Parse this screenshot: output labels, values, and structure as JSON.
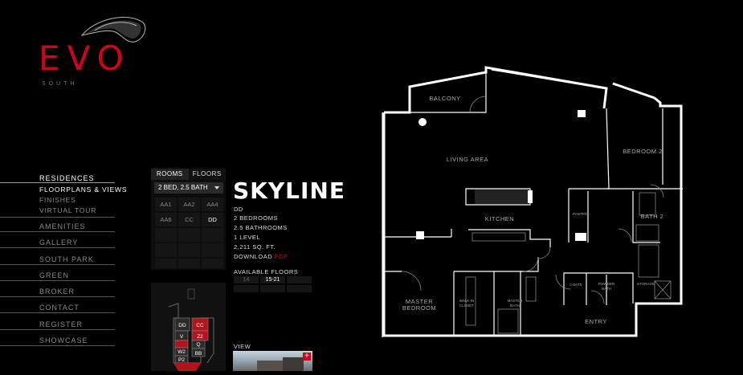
{
  "brand": {
    "name": "EVO",
    "sub": "SOUTH"
  },
  "nav": {
    "residences": "RESIDENCES",
    "sub": [
      "FLOORPLANS & VIEWS",
      "FINISHES",
      "VIRTUAL TOUR"
    ],
    "items": [
      "AMENITIES",
      "GALLERY",
      "SOUTH PARK",
      "GREEN",
      "BROKER",
      "CONTACT",
      "REGISTER",
      "SHOWCASE"
    ]
  },
  "panel": {
    "tabs": [
      "ROOMS",
      "FLOORS"
    ],
    "select": "2 BED, 2.5 BATH",
    "units": [
      "AA1",
      "AA2",
      "AA4",
      "AA6",
      "CC",
      "DD"
    ]
  },
  "unit": {
    "name": "SKYLINE",
    "code": "DD",
    "specs": [
      "2 BEDROOMS",
      "2.5 BATHROOMS",
      "1 LEVEL",
      "2,211 SQ. FT."
    ],
    "download": "DOWNLOAD",
    "pdf": "PDF",
    "floors_label": "AVAILABLE FLOORS",
    "floors": [
      "14",
      "15-21"
    ],
    "view_label": "VIEW"
  },
  "mini": {
    "labels": [
      "DD",
      "CC",
      "V",
      "Z2",
      "W2",
      "Q",
      "P2",
      "BB"
    ]
  },
  "rooms": {
    "balcony": "BALCONY",
    "living": "LIVING AREA",
    "bedroom2": "BEDROOM 2",
    "kitchen": "KITCHEN",
    "pantry": "PANTRY",
    "bath2": "BATH 2",
    "master_bed_1": "MASTER",
    "master_bed_2": "BEDROOM",
    "walkin_1": "WALK-IN",
    "walkin_2": "CLOSET",
    "master_bath_1": "MASTER",
    "master_bath_2": "BATH",
    "coats": "COATS",
    "powder_1": "POWDER",
    "powder_2": "BATH",
    "storage": "STORAGE",
    "entry": "ENTRY"
  },
  "colors": {
    "accent": "#d0021b",
    "bg": "#000000"
  }
}
